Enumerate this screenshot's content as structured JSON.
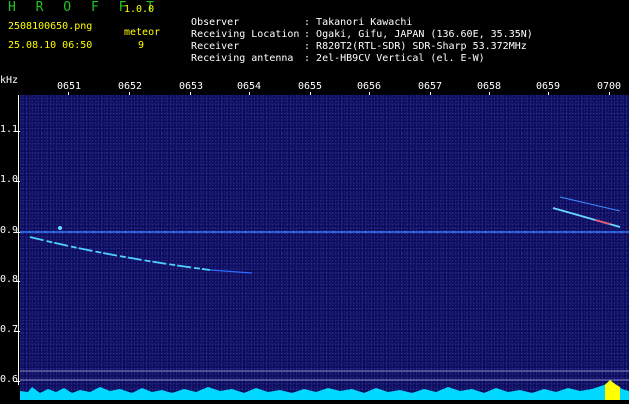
{
  "app": {
    "logo": "H R O F F T",
    "version": "1.0.0",
    "filename": "2508100650.png",
    "meteor_label": "meteor",
    "datetime": "25.08.10 06:50",
    "meteor_count": "9"
  },
  "info": [
    {
      "label": "Observer",
      "value": "Takanori Kawachi"
    },
    {
      "label": "Receiving Location",
      "value": "Ogaki, Gifu, JAPAN (136.60E, 35.35N)"
    },
    {
      "label": "Receiver",
      "value": "R820T2(RTL-SDR) SDR-Sharp 53.372MHz"
    },
    {
      "label": "Receiving antenna",
      "value": "2el-HB9CV Vertical (el. E-W)"
    }
  ],
  "axis": {
    "y_unit": "kHz",
    "y_ticks": [
      "1.1",
      "1.0",
      "0.9",
      "0.8",
      "0.7",
      "0.6"
    ],
    "x_ticks": [
      "0651",
      "0652",
      "0653",
      "0654",
      "0655",
      "0656",
      "0657",
      "0658",
      "0659",
      "0700"
    ]
  },
  "colors": {
    "background": "#0b0b5c",
    "accent_green": "#22c322",
    "accent_yellow": "#ffff00",
    "signal_cyan": "#00e5ff"
  }
}
